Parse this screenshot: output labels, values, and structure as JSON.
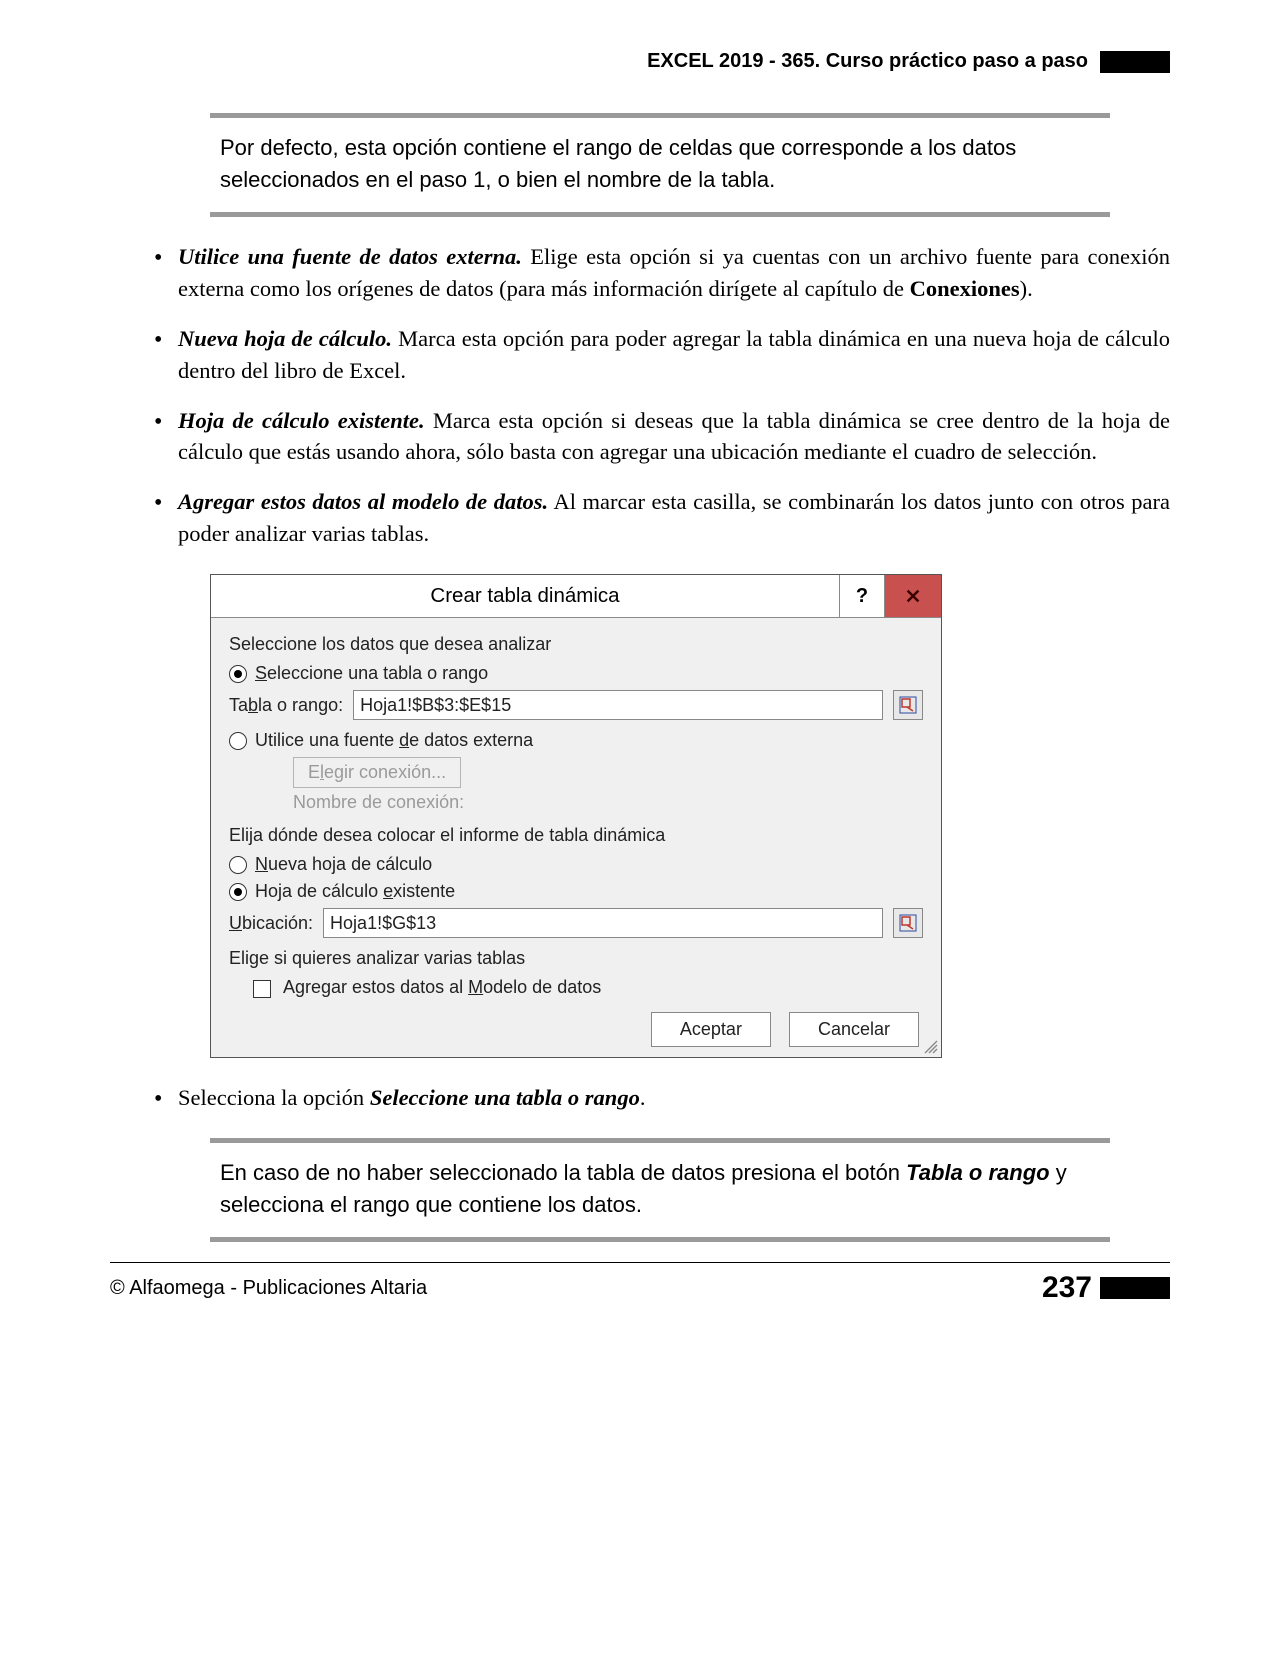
{
  "header": {
    "title": "EXCEL 2019 - 365. Curso práctico paso a paso"
  },
  "note1": "Por defecto, esta opción contiene el rango de celdas que corresponde a los datos seleccionados en el paso 1, o bien el nombre de la tabla.",
  "bullets": [
    {
      "lead": "Utilice una fuente de datos externa.",
      "rest_a": " Elige esta opción si ya cuentas con un archivo fuente para conexión externa como los orígenes de datos (para más información dirígete al capítulo de ",
      "bold": "Conexiones",
      "rest_b": ")."
    },
    {
      "lead": "Nueva hoja de cálculo.",
      "rest_a": " Marca esta opción para poder agregar la tabla dinámica en una nueva hoja de cálculo dentro del libro de Excel.",
      "bold": "",
      "rest_b": ""
    },
    {
      "lead": "Hoja de cálculo existente.",
      "rest_a": " Marca esta opción si deseas que la tabla dinámica se cree dentro de la hoja de cálculo que estás usando ahora, sólo basta con agregar una ubicación mediante el cuadro de selección.",
      "bold": "",
      "rest_b": ""
    },
    {
      "lead": "Agregar estos datos al modelo de datos.",
      "rest_a": " Al marcar esta casilla, se combinarán los datos junto con otros para poder analizar varias tablas.",
      "bold": "",
      "rest_b": ""
    }
  ],
  "dialog": {
    "title": "Crear tabla dinámica",
    "help": "?",
    "close": "x",
    "section1": "Seleccione los datos que desea analizar",
    "radio_table_pre": "S",
    "radio_table_post": "eleccione una tabla o rango",
    "field_table_pre": "Ta",
    "field_table_u": "b",
    "field_table_post": "la o rango:",
    "field_table_value": "Hoja1!$B$3:$E$15",
    "radio_extern_pre": "Utilice una fuente ",
    "radio_extern_u": "d",
    "radio_extern_post": "e datos externa",
    "choose_conn_pre": "E",
    "choose_conn_u": "l",
    "choose_conn_post": "egir conexión...",
    "conn_name": "Nombre de conexión:",
    "section2": "Elija dónde desea colocar el informe de tabla dinámica",
    "radio_new_pre": "N",
    "radio_new_post": "ueva hoja de cálculo",
    "radio_exist_pre": "Hoja de cálculo ",
    "radio_exist_u": "e",
    "radio_exist_post": "xistente",
    "field_loc_pre": "U",
    "field_loc_post": "bicación:",
    "field_loc_value": "Hoja1!$G$13",
    "section3": "Elige si quieres analizar varias tablas",
    "check_add_pre": "Agregar estos datos al ",
    "check_add_u": "M",
    "check_add_post": "odelo de datos",
    "ok": "Aceptar",
    "cancel": "Cancelar"
  },
  "bullet_after": {
    "pre": "Selecciona la opción ",
    "bold": "Seleccione una tabla o rango",
    "post": "."
  },
  "note2": {
    "a": "En caso de no haber seleccionado la tabla de datos presiona el botón ",
    "b": "Tabla o rango",
    "c": " y selecciona el rango que contiene los datos."
  },
  "footer": {
    "left": "© Alfaomega - Publicaciones Altaria",
    "page": "237"
  }
}
